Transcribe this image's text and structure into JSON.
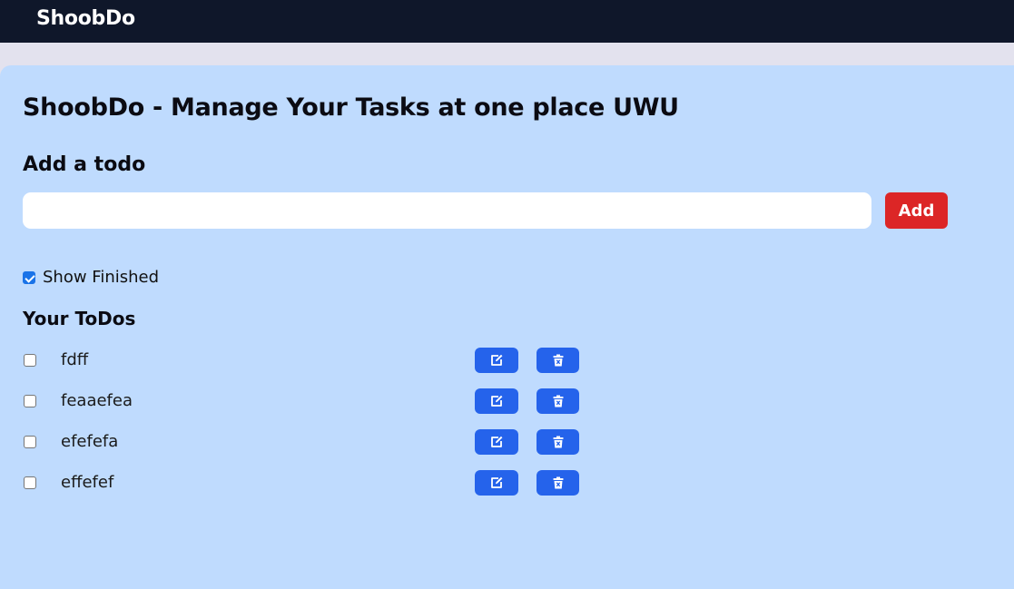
{
  "navbar": {
    "brand": "ShoobDo"
  },
  "main": {
    "title": "ShoobDo - Manage Your Tasks at one place UWU",
    "add_heading": "Add a todo",
    "input": {
      "value": "",
      "placeholder": ""
    },
    "add_label": "Add",
    "show_finished": {
      "label": "Show Finished",
      "checked": true
    },
    "todos_heading": "Your ToDos",
    "todos": [
      {
        "text": "fdff",
        "done": false
      },
      {
        "text": "feaaefea",
        "done": false
      },
      {
        "text": "efefefa",
        "done": false
      },
      {
        "text": "effefef",
        "done": false
      }
    ],
    "icons": {
      "edit": "edit-icon",
      "delete": "delete-icon"
    }
  },
  "colors": {
    "navbar_bg": "#0f172a",
    "page_bg": "#e3e2ee",
    "card_bg": "#bfdbfe",
    "add_button": "#dc2626",
    "action_button": "#2563eb"
  }
}
